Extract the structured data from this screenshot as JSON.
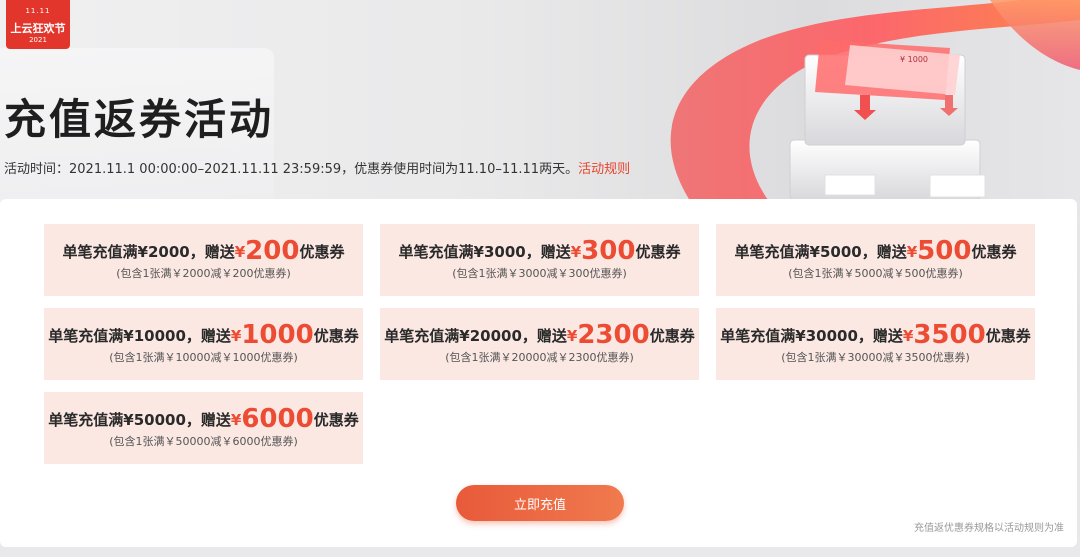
{
  "badge": {
    "top": "11.11",
    "text": "上云狂欢节",
    "year": "2021"
  },
  "page_title": "充值返券活动",
  "activity_time": "活动时间：2021.11.1 00:00:00–2021.11.11 23:59:59，优惠券使用时间为11.10–11.11两天。",
  "rules_link": "活动规则",
  "hero_bill_text": "¥ 1000",
  "tiers": [
    {
      "prefix": "单笔充值满¥2000，赠送",
      "yen": "¥",
      "amount": "200",
      "suffix": "优惠券",
      "sub": "(包含1张满￥2000减￥200优惠券)"
    },
    {
      "prefix": "单笔充值满¥3000，赠送",
      "yen": "¥",
      "amount": "300",
      "suffix": "优惠券",
      "sub": "(包含1张满￥3000减￥300优惠券)"
    },
    {
      "prefix": "单笔充值满¥5000，赠送",
      "yen": "¥",
      "amount": "500",
      "suffix": "优惠券",
      "sub": "(包含1张满￥5000减￥500优惠券)"
    },
    {
      "prefix": "单笔充值满¥10000，赠送",
      "yen": "¥",
      "amount": "1000",
      "suffix": "优惠券",
      "sub": "(包含1张满￥10000减￥1000优惠券)"
    },
    {
      "prefix": "单笔充值满¥20000，赠送",
      "yen": "¥",
      "amount": "2300",
      "suffix": "优惠券",
      "sub": "(包含1张满￥20000减￥2300优惠券)"
    },
    {
      "prefix": "单笔充值满¥30000，赠送",
      "yen": "¥",
      "amount": "3500",
      "suffix": "优惠券",
      "sub": "(包含1张满￥30000减￥3500优惠券)"
    },
    {
      "prefix": "单笔充值满¥50000，赠送",
      "yen": "¥",
      "amount": "6000",
      "suffix": "优惠券",
      "sub": "(包含1张满￥50000减￥6000优惠券)"
    }
  ],
  "cta_label": "立即充值",
  "footnote": "充值返优惠券规格以活动规则为准",
  "colors": {
    "accent": "#ec4b34",
    "tier_bg": "#fbe8e3",
    "badge": "#e2362c"
  }
}
